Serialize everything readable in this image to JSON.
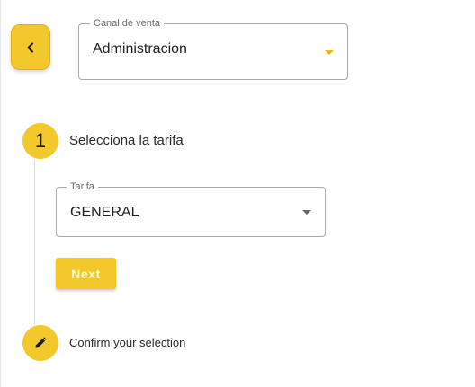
{
  "header": {
    "back_button": {
      "icon": "chevron-left-icon"
    },
    "canal_field": {
      "label": "Canal de venta",
      "value": "Administracion",
      "caret_color": "#e8b91a"
    }
  },
  "stepper": {
    "steps": [
      {
        "number": "1",
        "label": "Selecciona la tarifa",
        "tarifa_field": {
          "label": "Tarifa",
          "value": "GENERAL"
        },
        "next_label": "Next"
      },
      {
        "icon": "pencil-icon",
        "label": "Confirm your selection"
      }
    ]
  },
  "colors": {
    "accent": "#f2c82a",
    "border": "#a8a8a8",
    "text": "#212121"
  }
}
